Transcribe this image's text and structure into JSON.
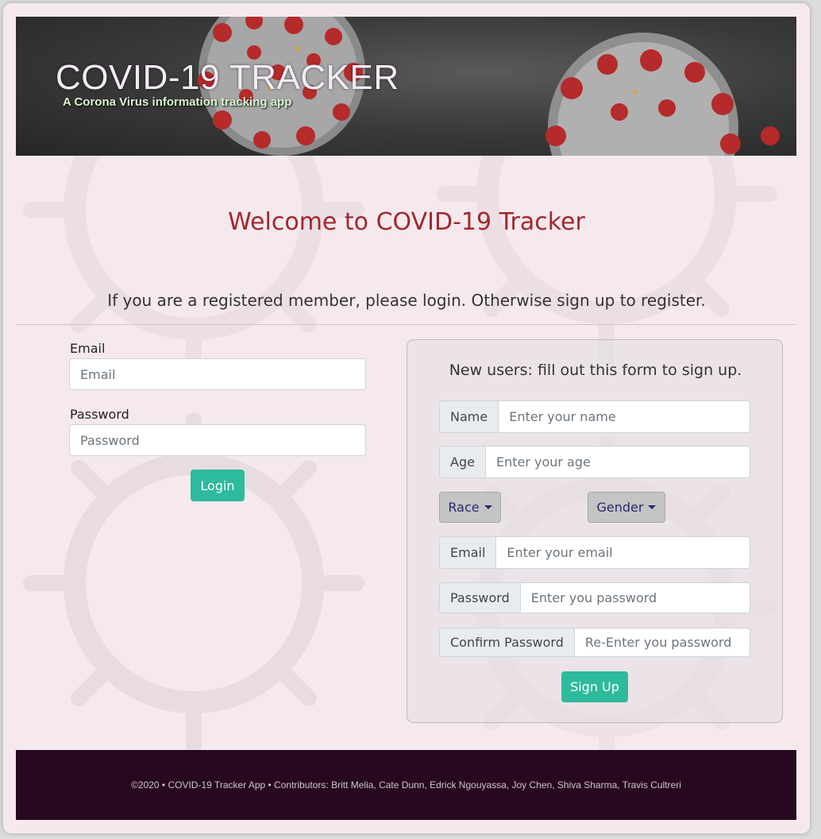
{
  "banner": {
    "title": "COVID-19 TRACKER",
    "subtitle": "A Corona Virus information tracking app"
  },
  "welcome": "Welcome to COVID-19 Tracker",
  "instructions": "If you are a registered member, please login. Otherwise sign up to register.",
  "login": {
    "email_label": "Email",
    "email_placeholder": "Email",
    "password_label": "Password",
    "password_placeholder": "Password",
    "button": "Login"
  },
  "signup": {
    "title": "New users: fill out this form to sign up.",
    "name_label": "Name",
    "name_placeholder": "Enter your name",
    "age_label": "Age",
    "age_placeholder": "Enter your age",
    "race_button": "Race",
    "gender_button": "Gender",
    "email_label": "Email",
    "email_placeholder": "Enter your email",
    "password_label": "Password",
    "password_placeholder": "Enter you password",
    "confirm_label": "Confirm Password",
    "confirm_placeholder": "Re-Enter you password",
    "button": "Sign Up"
  },
  "footer": "©2020 • COVID-19 Tracker App • Contributors: Britt Melia, Cate Dunn, Edrick Ngouyassa, Joy Chen, Shiva Sharma, Travis Cultreri",
  "colors": {
    "accent": "#2dba9d",
    "heading": "#a0282e",
    "background": "#f5e9ee",
    "footer": "#27081e"
  }
}
